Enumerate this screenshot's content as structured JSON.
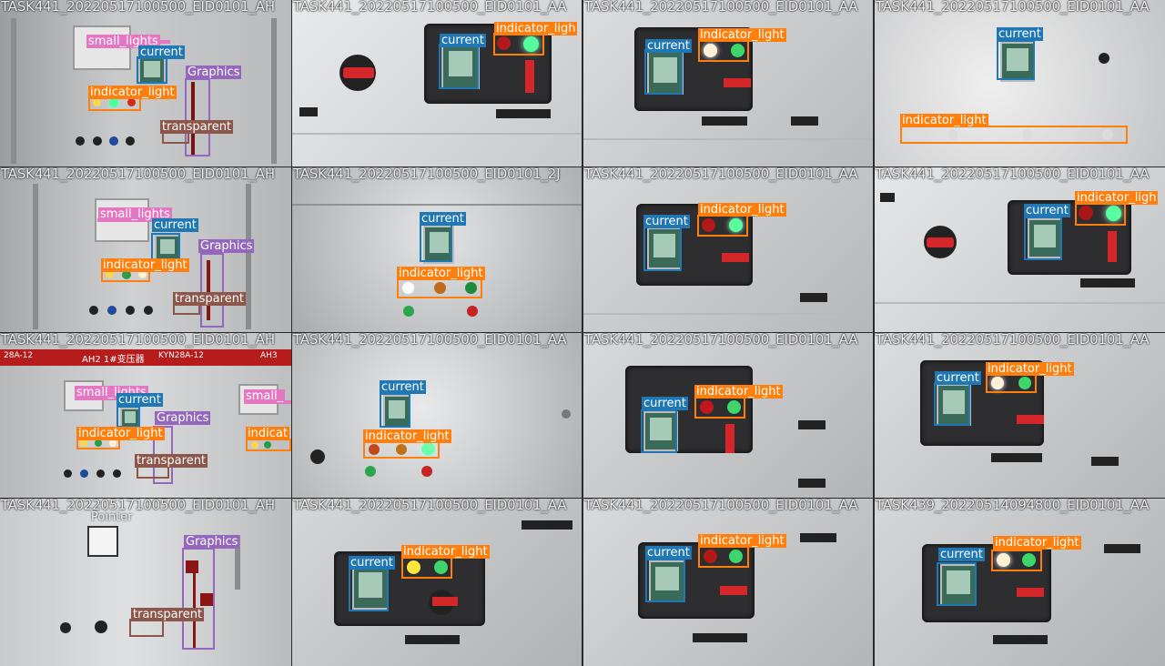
{
  "colors": {
    "current": "#1f77b4",
    "indicator_light": "#ff7f0e",
    "small_lights": "#e377c2",
    "Graphics": "#9467bd",
    "transparent": "#8c564b",
    "Pointer": "#c7c7c7"
  },
  "labels": {
    "current": "current",
    "indicator_light": "indicator_light",
    "indicator_ligh": "indicator_ligh",
    "indicat": "indicat",
    "small_lights": "small_lights",
    "small_": "small_",
    "Graphics": "Graphics",
    "transparent": "transparent",
    "Pointer": "Pointer"
  },
  "tiles": [
    {
      "id": "t00",
      "filename": "TASK441_20220517100500_EID0101_AH"
    },
    {
      "id": "t01",
      "filename": "TASK441_20220517100500_EID0101_AA"
    },
    {
      "id": "t02",
      "filename": "TASK441_20220517100500_EID0101_AA"
    },
    {
      "id": "t03",
      "filename": "TASK441_20220517100500_EID0101_AA"
    },
    {
      "id": "t10",
      "filename": "TASK441_20220517100500_EID0101_AH"
    },
    {
      "id": "t11",
      "filename": "TASK441_20220517100500_EID0101_2J"
    },
    {
      "id": "t12",
      "filename": "TASK441_20220517100500_EID0101_AA"
    },
    {
      "id": "t13",
      "filename": "TASK441_20220517100500_EID0101_AA"
    },
    {
      "id": "t20",
      "filename": "TASK441_20220517100500_EID0101_AH"
    },
    {
      "id": "t21",
      "filename": "TASK441_20220517100500_EID0101_AA"
    },
    {
      "id": "t22",
      "filename": "TASK441_20220517100500_EID0101_AA"
    },
    {
      "id": "t23",
      "filename": "TASK441_20220517100500_EID0101_AA"
    },
    {
      "id": "t30",
      "filename": "TASK441_20220517100500_EID0101_AH"
    },
    {
      "id": "t31",
      "filename": "TASK441_20220517100500_EID0101_AA"
    },
    {
      "id": "t32",
      "filename": "TASK441_20220517100500_EID0101_AA"
    },
    {
      "id": "t33",
      "filename": "TASK439_20220514094800_EID0101_AA"
    }
  ],
  "banner": {
    "text": "AH2 1#变压器",
    "left": "KYN28A-12",
    "left2": "28A-12",
    "right": "AH3"
  }
}
